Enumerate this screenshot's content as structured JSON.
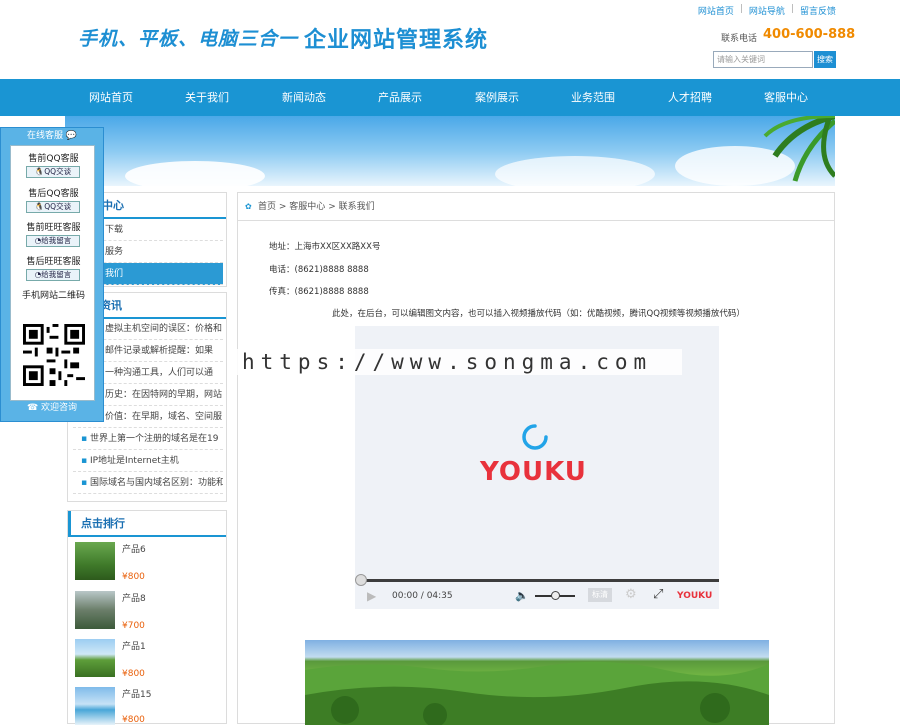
{
  "header": {
    "logo_slogan": "手机、平板、电脑三合一",
    "logo_title": "企业网站管理系统",
    "top_links": [
      "网站首页",
      "网站导航",
      "留言反馈"
    ],
    "phone_label": "联系电话",
    "phone_number": "400-600-888",
    "search_placeholder": "请输入关键词",
    "search_button": "搜索"
  },
  "nav": {
    "items": [
      "网站首页",
      "关于我们",
      "新闻动态",
      "产品展示",
      "案例展示",
      "业务范围",
      "人才招聘",
      "客服中心"
    ]
  },
  "sidebar": {
    "service": {
      "title": "中心",
      "items": [
        "下载",
        "服务",
        "我们"
      ]
    },
    "news": {
      "title": "资讯",
      "items": [
        "虚拟主机空间的误区：价格和",
        "邮件记录或解析提醒：如果",
        "一种沟通工具，人们可以通",
        "历史：在因特网的早期，网站",
        "价值：在早期，域名、空间服",
        "世界上第一个注册的域名是在19",
        "IP地址是Internet主机",
        "国际域名与国内域名区别：功能和"
      ]
    },
    "ranking": {
      "title": "点击排行",
      "products": [
        {
          "name": "产品6",
          "price": "¥800"
        },
        {
          "name": "产品8",
          "price": "¥700"
        },
        {
          "name": "产品1",
          "price": "¥800"
        },
        {
          "name": "产品15",
          "price": "¥800"
        }
      ]
    }
  },
  "float_panel": {
    "title": "在线客服",
    "services": [
      {
        "label": "售前QQ客服",
        "button": "QQ交谈"
      },
      {
        "label": "售后QQ客服",
        "button": "QQ交谈"
      },
      {
        "label": "售前旺旺客服",
        "button": "给我留言"
      },
      {
        "label": "售后旺旺客服",
        "button": "给我留言"
      }
    ],
    "qr_label": "手机网站二维码",
    "footer": "欢迎咨询"
  },
  "main": {
    "breadcrumb": [
      "首页",
      "客服中心",
      "联系我们"
    ],
    "address_label": "地址：",
    "address_value": "上海市XX区XX路XX号",
    "tel_label": "电话：",
    "tel_value": "(8621)8888 8888",
    "fax_label": "传真：",
    "fax_value": "(8621)8888 8888",
    "note": "此处，在后台，可以编辑图文内容，也可以插入视频播放代码（如：优酷视频，腾讯QQ视频等视频播放代码）",
    "video": {
      "brand": "YOUKU",
      "time": "00:00 / 04:35",
      "quality": "标清"
    }
  },
  "watermark": "https://www.songma.com",
  "colors": {
    "accent": "#1a95d3",
    "price": "#e9600b",
    "phone": "#f08a00",
    "youku_red": "#e8323c",
    "youku_blue": "#22a4e8"
  }
}
